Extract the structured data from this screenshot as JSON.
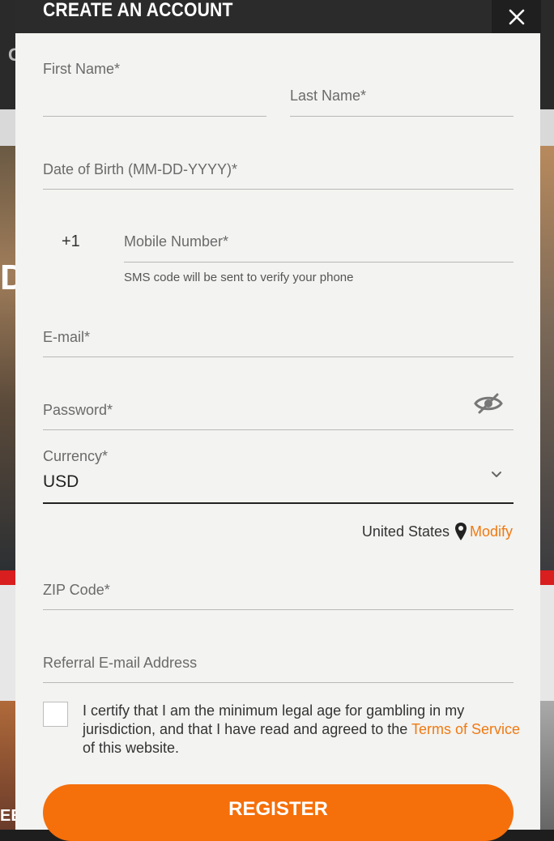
{
  "modal": {
    "title": "CREATE AN ACCOUNT",
    "close_icon": "close-icon"
  },
  "form": {
    "first_name_label": "First Name*",
    "last_name_label": "Last Name*",
    "dob_label": "Date of Birth (MM-DD-YYYY)*",
    "phone_prefix": "+1",
    "mobile_label": "Mobile Number*",
    "mobile_hint": "SMS code will be sent to verify your phone",
    "email_label": "E-mail*",
    "password_label": "Password*",
    "password_toggle_icon": "eye-slash-icon",
    "currency_label": "Currency*",
    "currency_value": "USD",
    "currency_dropdown_icon": "chevron-down-icon",
    "location_country": "United States",
    "location_icon": "map-pin-icon",
    "location_modify": "Modify",
    "zip_label": "ZIP Code*",
    "referral_label": "Referral E-mail Address",
    "certify_text_before": "I certify that I am the minimum legal age for gambling in my jurisdiction, and that I have read and agreed to the ",
    "terms_link": "Terms of Service",
    "certify_text_after": " of this website.",
    "register_label": "REGISTER"
  },
  "colors": {
    "accent": "#f56f0a",
    "link": "#f07a12",
    "header_bg": "#2b2b2b",
    "modal_bg": "#f3f3f1"
  }
}
